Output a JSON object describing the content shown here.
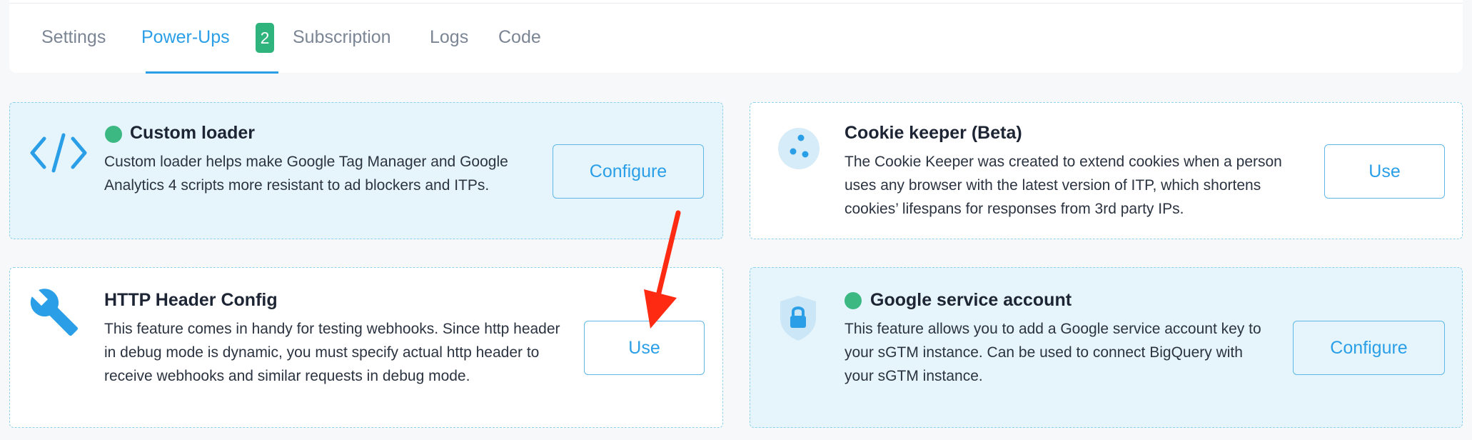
{
  "tabs": [
    {
      "label": "Settings"
    },
    {
      "label": "Power-Ups",
      "badge": "2"
    },
    {
      "label": "Subscription"
    },
    {
      "label": "Logs"
    },
    {
      "label": "Code"
    }
  ],
  "cards": [
    {
      "title": "Custom loader",
      "description": "Custom loader helps make Google Tag Manager and Google Analytics 4 scripts more resistant to ad blockers and ITPs.",
      "button": "Configure",
      "icon": "code-icon",
      "enabled": true
    },
    {
      "title": "Cookie keeper (Beta)",
      "description": "The Cookie Keeper was created to extend cookies when a person uses any browser with the latest version of ITP, which shortens cookies’ lifespans for responses from 3rd party IPs.",
      "button": "Use",
      "icon": "cookie-icon",
      "enabled": false
    },
    {
      "title": "HTTP Header Config",
      "description": "This feature comes in handy for testing webhooks. Since http header in debug mode is dynamic, you must specify actual http header to receive webhooks and similar requests in debug mode.",
      "button": "Use",
      "icon": "wrench-icon",
      "enabled": false
    },
    {
      "title": "Google service account",
      "description": "This feature allows you to add a Google service account key to your sGTM instance. Can be used to connect BigQuery with your sGTM instance.",
      "button": "Configure",
      "icon": "shield-lock-icon",
      "enabled": true
    }
  ],
  "colors": {
    "accent": "#2a9fe7",
    "badge": "#2fb47d",
    "status_dot": "#3cb883",
    "active_card_bg": "#e6f5fc",
    "annotation_arrow": "#ff2a12"
  }
}
